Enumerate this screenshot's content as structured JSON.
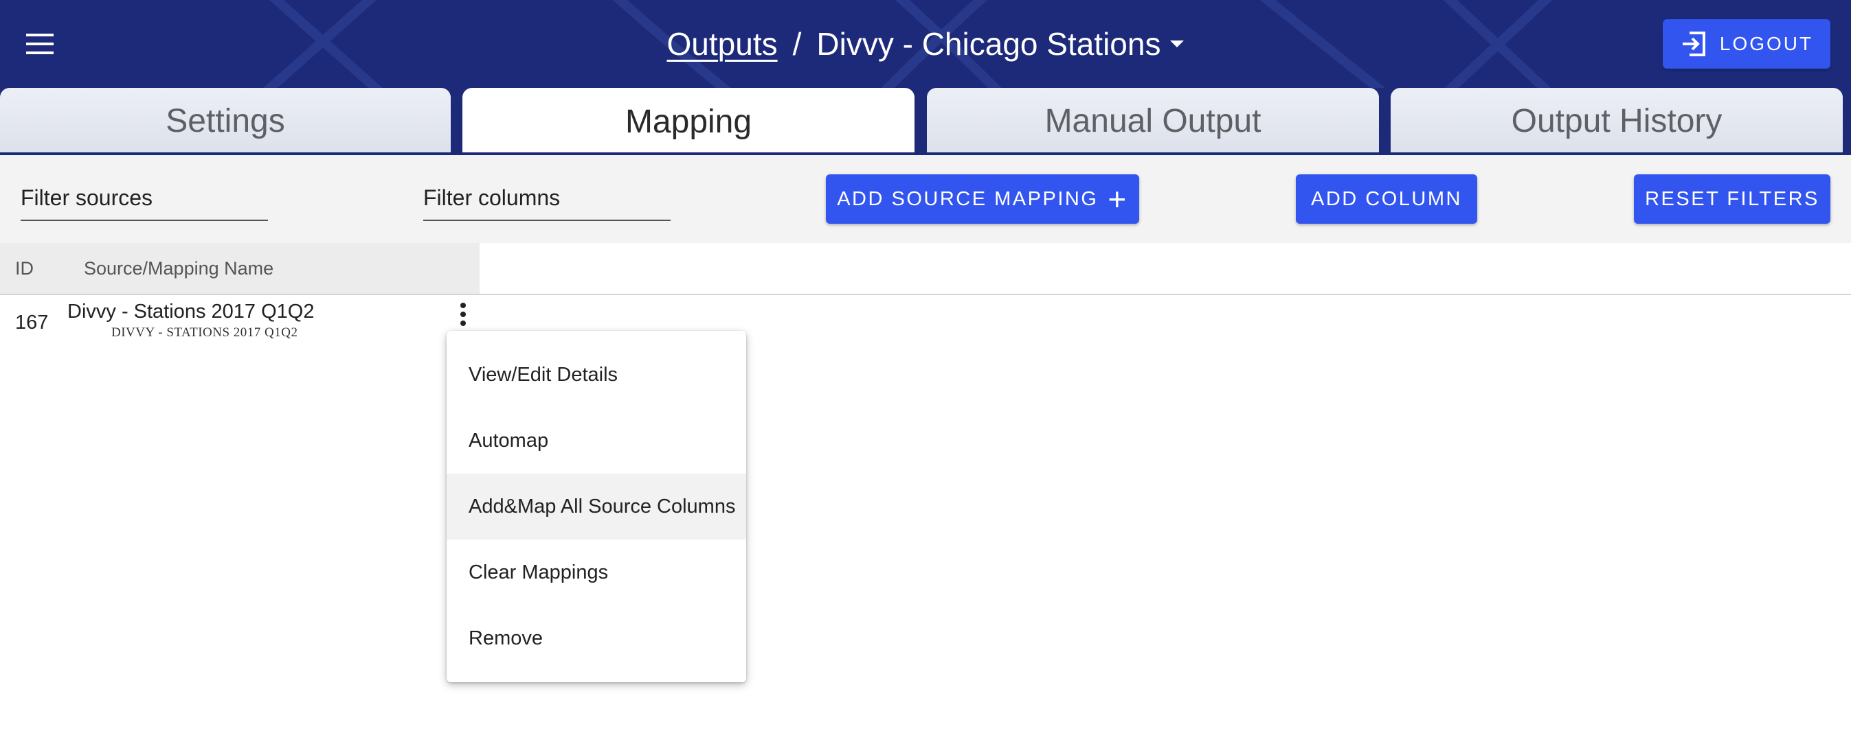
{
  "header": {
    "breadcrumb_parent": "Outputs",
    "separator": "/",
    "current_title": "Divvy - Chicago Stations",
    "logout_label": "LOGOUT",
    "colors": {
      "background": "#1d2a7a",
      "accent": "#3355ef"
    }
  },
  "tabs": [
    {
      "label": "Settings",
      "active": false
    },
    {
      "label": "Mapping",
      "active": true
    },
    {
      "label": "Manual Output",
      "active": false
    },
    {
      "label": "Output History",
      "active": false
    }
  ],
  "filters": {
    "sources_placeholder": "Filter sources",
    "columns_placeholder": "Filter columns",
    "add_source_mapping_label": "ADD SOURCE MAPPING",
    "add_column_label": "ADD COLUMN",
    "reset_filters_label": "RESET FILTERS"
  },
  "table": {
    "columns": [
      "ID",
      "Source/Mapping Name"
    ],
    "rows": [
      {
        "id": "167",
        "name": "Divvy - Stations 2017 Q1Q2",
        "subtitle": "DIVVY - STATIONS 2017 Q1Q2"
      }
    ]
  },
  "context_menu": {
    "items": [
      {
        "label": "View/Edit Details"
      },
      {
        "label": "Automap"
      },
      {
        "label": "Add&Map All Source Columns",
        "highlighted": true
      },
      {
        "label": "Clear Mappings"
      },
      {
        "label": "Remove"
      }
    ]
  },
  "icons": {
    "menu": "hamburger-menu-icon",
    "logout": "logout-icon",
    "dropdown": "caret-down-icon",
    "add": "plus-icon",
    "row_actions": "more-vert-icon"
  }
}
